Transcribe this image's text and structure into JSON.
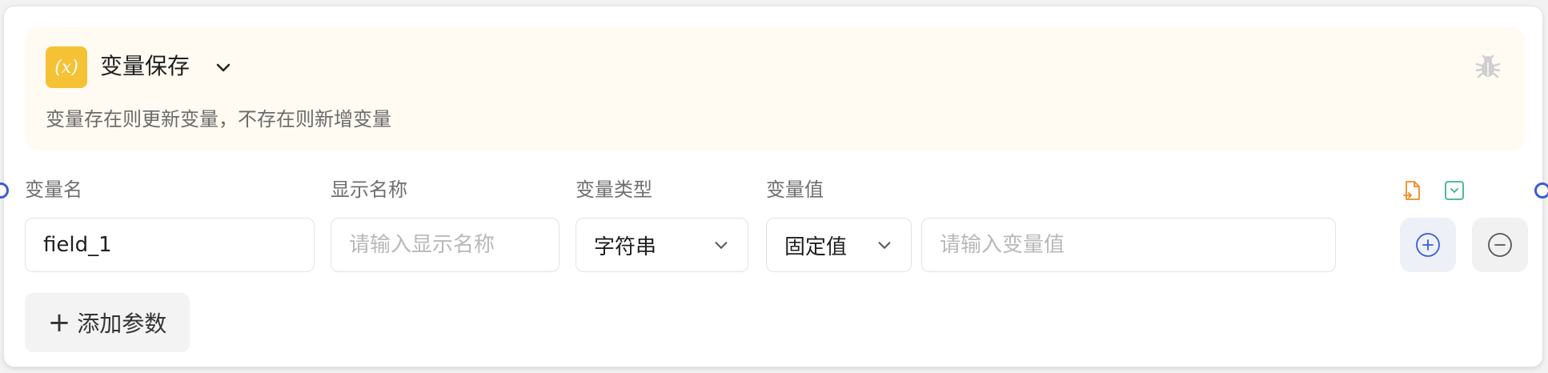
{
  "node": {
    "icon": "variable-x-icon",
    "icon_glyph": "(x)",
    "title": "变量保存",
    "description": "变量存在则更新变量，不存在则新增变量"
  },
  "columns": {
    "name": "变量名",
    "display_name": "显示名称",
    "type": "变量类型",
    "value": "变量值"
  },
  "row": {
    "name_value": "field_1",
    "display_name_placeholder": "请输入显示名称",
    "type_value": "字符串",
    "value_mode": "固定值",
    "value_placeholder": "请输入变量值"
  },
  "add_param_label": "添加参数",
  "add_param_plus": "+",
  "colors": {
    "accent_yellow": "#f5c236",
    "header_bg": "#fffbf2",
    "port_blue": "#3a5bd6",
    "file_icon_orange": "#f08a24",
    "dropdown_icon_green": "#3bb38a"
  }
}
